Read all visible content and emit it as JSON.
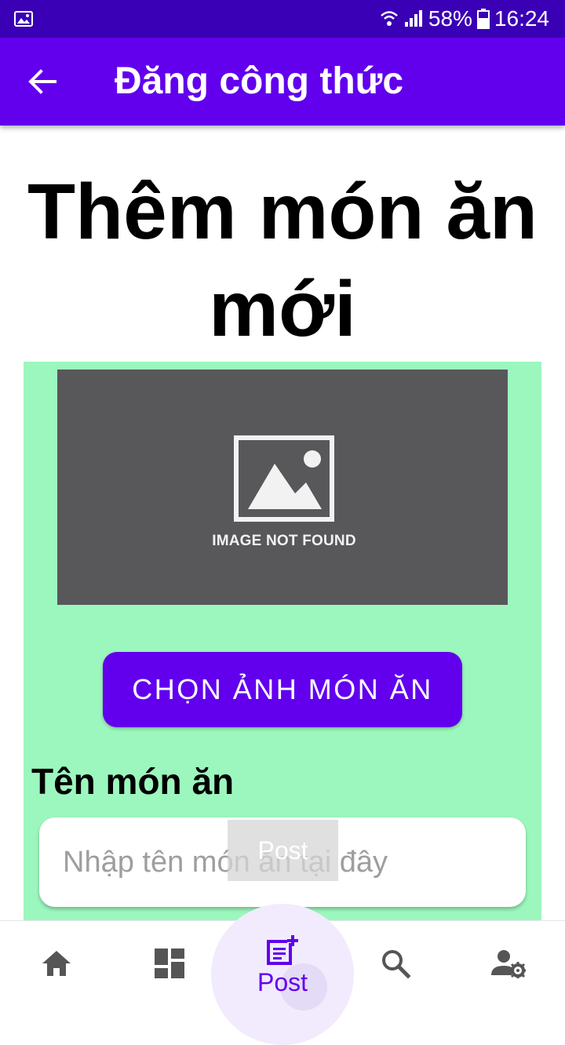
{
  "status_bar": {
    "battery": "58%",
    "time": "16:24"
  },
  "app_bar": {
    "title": "Đăng công thức"
  },
  "page": {
    "heading": "Thêm món ăn mới"
  },
  "image_placeholder": {
    "text": "IMAGE NOT FOUND"
  },
  "pick_button": {
    "label": "CHỌN ẢNH MÓN ĂN"
  },
  "name_field": {
    "label": "Tên món ăn",
    "placeholder": "Nhập tên món ăn tại đây"
  },
  "overlay": {
    "text": "Post"
  },
  "bottom_nav": {
    "items": [
      {
        "icon": "home-icon",
        "label": ""
      },
      {
        "icon": "dashboard-icon",
        "label": ""
      },
      {
        "icon": "post-add-icon",
        "label": "Post"
      },
      {
        "icon": "search-icon",
        "label": ""
      },
      {
        "icon": "account-settings-icon",
        "label": ""
      }
    ],
    "active": "Post"
  },
  "colors": {
    "primary": "#6200ee",
    "status_bar": "#3a00b5",
    "panel": "#9cf7be"
  }
}
